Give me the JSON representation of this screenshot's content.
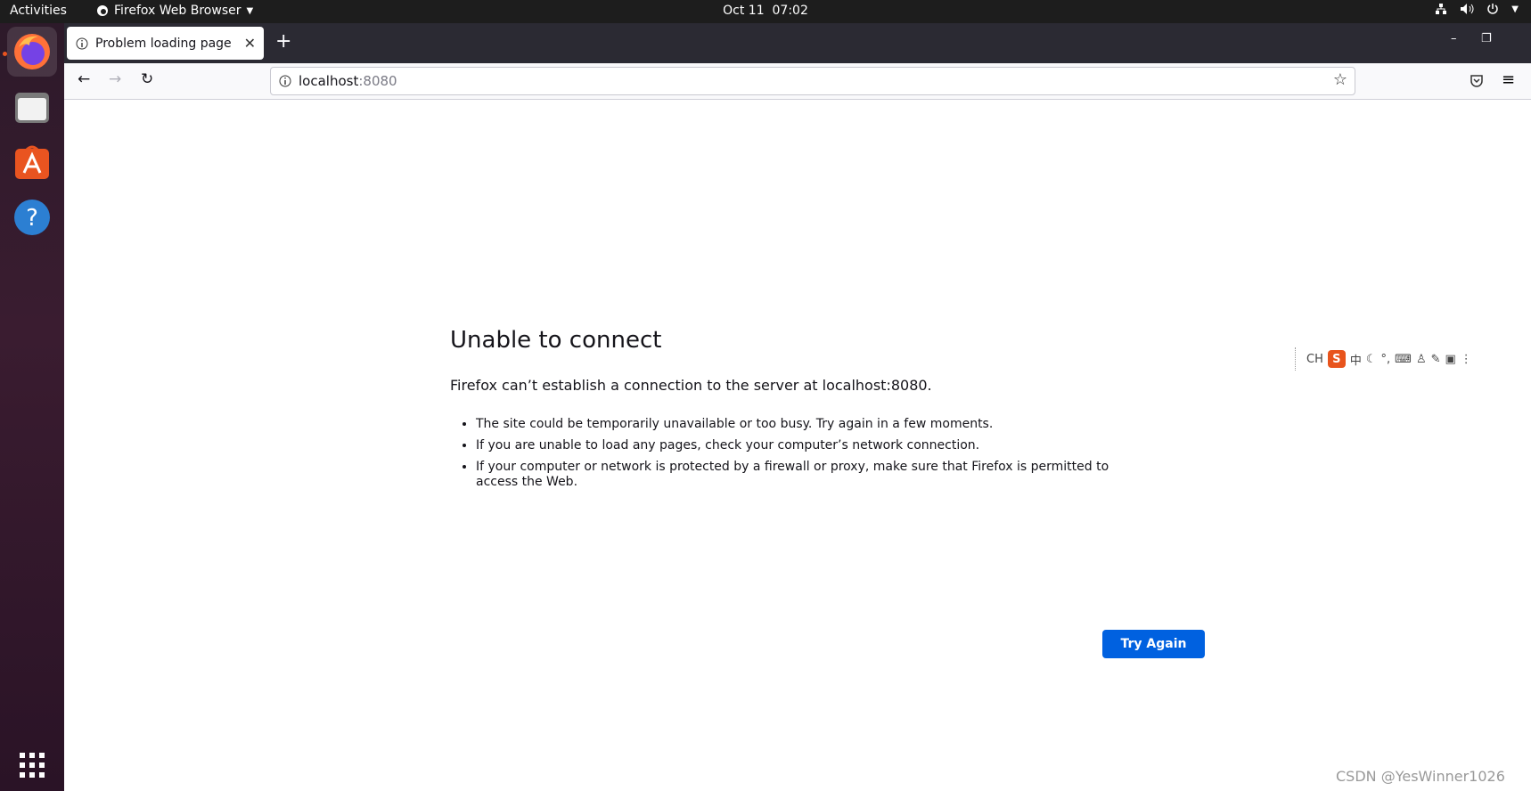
{
  "topbar": {
    "activities": "Activities",
    "app_name": "Firefox Web Browser",
    "date": "Oct 11",
    "time": "07:02"
  },
  "dock": {
    "items": [
      {
        "name": "firefox-icon"
      },
      {
        "name": "files-icon"
      },
      {
        "name": "software-center-icon"
      },
      {
        "name": "help-icon"
      },
      {
        "name": "app-grid-icon"
      }
    ]
  },
  "browser": {
    "tab_title": "Problem loading page",
    "url_host": "localhost",
    "url_port": ":8080"
  },
  "error_page": {
    "title": "Unable to connect",
    "subtitle": "Firefox can’t establish a connection to the server at localhost:8080.",
    "bullets": [
      "The site could be temporarily unavailable or too busy. Try again in a few moments.",
      "If you are unable to load any pages, check your computer’s network connection.",
      "If your computer or network is protected by a firewall or proxy, make sure that Firefox is permitted to access the Web."
    ],
    "button": "Try Again"
  },
  "ime_toolbar": {
    "mode": "CH",
    "brand": "S",
    "lang": "中"
  },
  "watermark": "CSDN @YesWinner1026",
  "colors": {
    "accent": "#0061e0",
    "ubuntu_orange": "#e95420"
  }
}
